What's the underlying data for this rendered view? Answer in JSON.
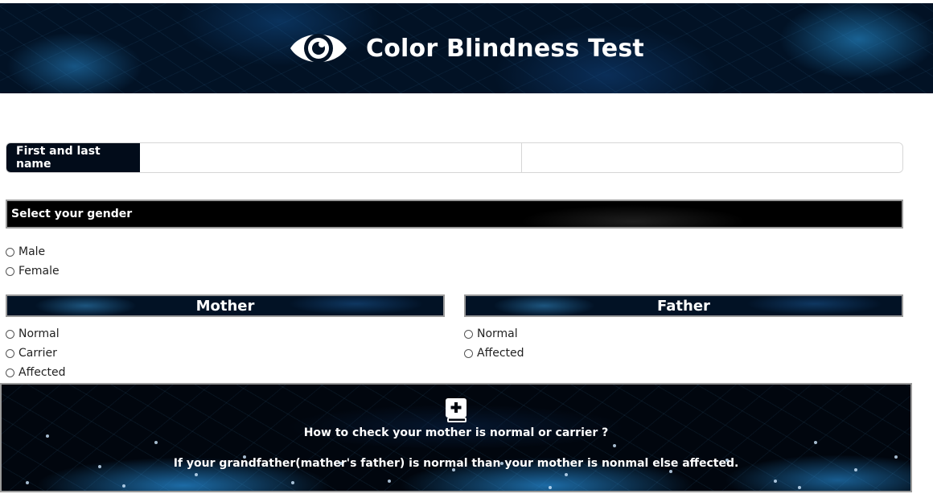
{
  "header": {
    "title": "Color Blindness Test",
    "icon": "eye-icon"
  },
  "name_row": {
    "label": "First and last name",
    "first_value": "",
    "last_value": ""
  },
  "gender": {
    "heading": "Select your gender",
    "options": [
      "Male",
      "Female"
    ]
  },
  "mother": {
    "heading": "Mother",
    "options": [
      "Normal",
      "Carrier",
      "Affected"
    ]
  },
  "father": {
    "heading": "Father",
    "options": [
      "Normal",
      "Affected"
    ]
  },
  "info": {
    "icon": "medical-book-icon",
    "question": "How to check your mother is normal or carrier ?",
    "answer": "If your grandfather(mather's father) is normal than your mother is nonmal else affected."
  },
  "colors": {
    "banner_dark": "#021225",
    "text_light": "#ffffff",
    "border_gray": "#9a9a9a"
  }
}
